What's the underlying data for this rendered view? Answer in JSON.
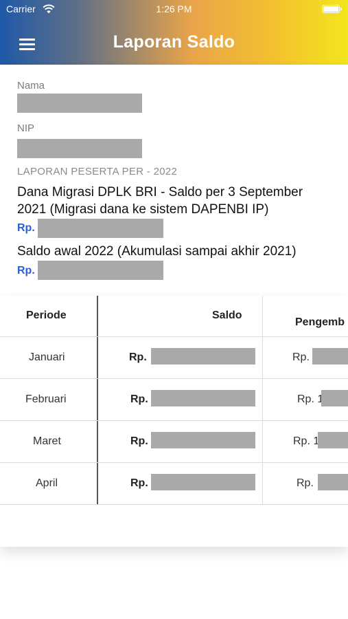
{
  "status_bar": {
    "carrier": "Carrier",
    "time": "1:26 PM"
  },
  "header": {
    "title": "Laporan Saldo"
  },
  "info": {
    "nama_label": "Nama",
    "nip_label": "NIP",
    "report_heading": "LAPORAN PESERTA PER - 2022",
    "migration_desc": "Dana Migrasi DPLK BRI - Saldo per 3 September 2021 (Migrasi dana ke sistem DAPENBI IP)",
    "migration_rp": "Rp.",
    "opening_desc": "Saldo awal 2022 (Akumulasi sampai akhir 2021)",
    "opening_rp": "Rp."
  },
  "table": {
    "headers": [
      "Periode",
      "Saldo",
      "Pengemb"
    ],
    "rows": [
      {
        "periode": "Januari",
        "saldo_rp": "Rp.",
        "third_rp": "Rp."
      },
      {
        "periode": "Februari",
        "saldo_rp": "Rp.",
        "third_rp": "Rp. 1"
      },
      {
        "periode": "Maret",
        "saldo_rp": "Rp.",
        "third_rp": "Rp. 1"
      },
      {
        "periode": "April",
        "saldo_rp": "Rp.",
        "third_rp": "Rp."
      }
    ]
  },
  "colors": {
    "accent_blue": "#2a5fd0",
    "redaction": "#a9a9a9"
  },
  "icons": [
    "wifi-icon",
    "battery-icon",
    "menu-icon"
  ]
}
